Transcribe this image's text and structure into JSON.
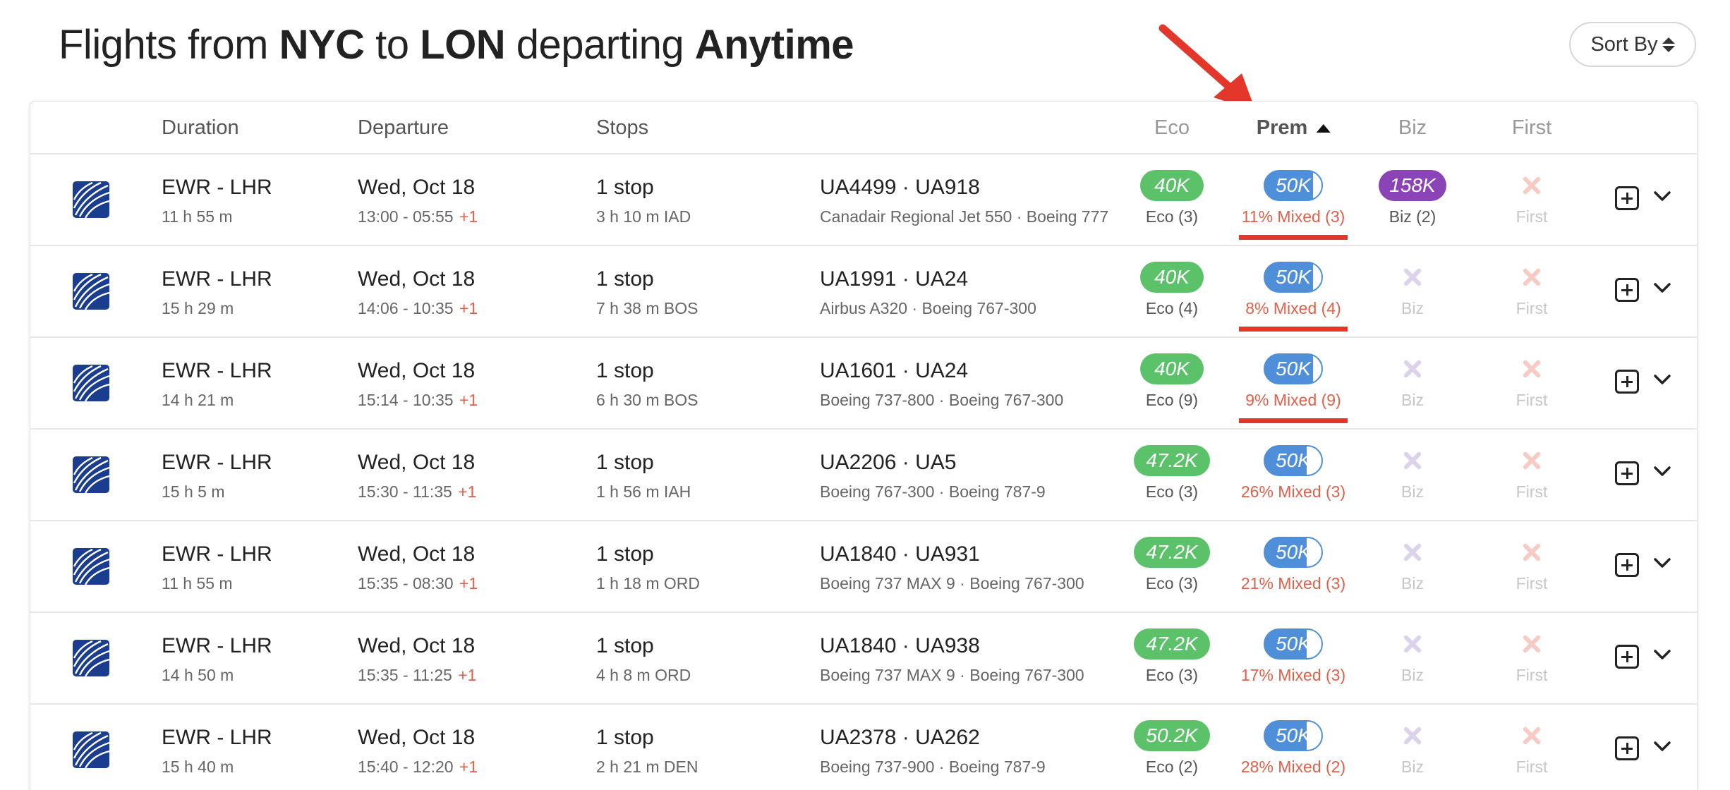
{
  "title": {
    "prefix": "Flights from",
    "origin": "NYC",
    "to": "to",
    "destination": "LON",
    "departing": "departing",
    "when": "Anytime"
  },
  "sort_label": "Sort By",
  "columns": {
    "duration": "Duration",
    "departure": "Departure",
    "stops": "Stops",
    "eco": "Eco",
    "prem": "Prem",
    "biz": "Biz",
    "first": "First"
  },
  "colors": {
    "eco": "#5cc26a",
    "prem": "#4f8fd9",
    "biz": "#8b44b8",
    "mixed_text": "#e0604a",
    "annotation": "#e2372a",
    "airline_logo": "#1a3d8f"
  },
  "rows": [
    {
      "route": "EWR - LHR",
      "duration": "11 h 55 m",
      "date": "Wed, Oct 18",
      "time": "13:00 - 05:55",
      "plus": "+1",
      "stops": "1 stop",
      "layover": "3 h 10 m  IAD",
      "flights": "UA4499  ·  UA918",
      "aircraft": "Canadair Regional Jet 550  ·  Boeing 777",
      "eco_price": "40K",
      "eco_sub": "Eco (3)",
      "prem_price": "50K",
      "prem_sub": "11% Mixed (3)",
      "biz_price": "158K",
      "biz_sub": "Biz (2)",
      "first_label": "First",
      "underline": true
    },
    {
      "route": "EWR - LHR",
      "duration": "15 h 29 m",
      "date": "Wed, Oct 18",
      "time": "14:06 - 10:35",
      "plus": "+1",
      "stops": "1 stop",
      "layover": "7 h 38 m  BOS",
      "flights": "UA1991  ·  UA24",
      "aircraft": "Airbus A320  ·  Boeing 767-300",
      "eco_price": "40K",
      "eco_sub": "Eco (4)",
      "prem_price": "50K",
      "prem_sub": "8% Mixed (4)",
      "biz_label": "Biz",
      "first_label": "First",
      "underline": true
    },
    {
      "route": "EWR - LHR",
      "duration": "14 h 21 m",
      "date": "Wed, Oct 18",
      "time": "15:14 - 10:35",
      "plus": "+1",
      "stops": "1 stop",
      "layover": "6 h 30 m  BOS",
      "flights": "UA1601  ·  UA24",
      "aircraft": "Boeing 737-800  ·  Boeing 767-300",
      "eco_price": "40K",
      "eco_sub": "Eco (9)",
      "prem_price": "50K",
      "prem_sub": "9% Mixed (9)",
      "biz_label": "Biz",
      "first_label": "First",
      "underline": true
    },
    {
      "route": "EWR - LHR",
      "duration": "15 h 5 m",
      "date": "Wed, Oct 18",
      "time": "15:30 - 11:35",
      "plus": "+1",
      "stops": "1 stop",
      "layover": "1 h 56 m  IAH",
      "flights": "UA2206  ·  UA5",
      "aircraft": "Boeing 767-300  ·  Boeing 787-9",
      "eco_price": "47.2K",
      "eco_sub": "Eco (3)",
      "prem_price": "50K",
      "prem_sub": "26% Mixed (3)",
      "biz_label": "Biz",
      "first_label": "First",
      "underline": false
    },
    {
      "route": "EWR - LHR",
      "duration": "11 h 55 m",
      "date": "Wed, Oct 18",
      "time": "15:35 - 08:30",
      "plus": "+1",
      "stops": "1 stop",
      "layover": "1 h 18 m  ORD",
      "flights": "UA1840  ·  UA931",
      "aircraft": "Boeing 737 MAX 9  ·  Boeing 767-300",
      "eco_price": "47.2K",
      "eco_sub": "Eco (3)",
      "prem_price": "50K",
      "prem_sub": "21% Mixed (3)",
      "biz_label": "Biz",
      "first_label": "First",
      "underline": false
    },
    {
      "route": "EWR - LHR",
      "duration": "14 h 50 m",
      "date": "Wed, Oct 18",
      "time": "15:35 - 11:25",
      "plus": "+1",
      "stops": "1 stop",
      "layover": "4 h 8 m  ORD",
      "flights": "UA1840  ·  UA938",
      "aircraft": "Boeing 737 MAX 9  ·  Boeing 767-300",
      "eco_price": "47.2K",
      "eco_sub": "Eco (3)",
      "prem_price": "50K",
      "prem_sub": "17% Mixed (3)",
      "biz_label": "Biz",
      "first_label": "First",
      "underline": false
    },
    {
      "route": "EWR - LHR",
      "duration": "15 h 40 m",
      "date": "Wed, Oct 18",
      "time": "15:40 - 12:20",
      "plus": "+1",
      "stops": "1 stop",
      "layover": "2 h 21 m  DEN",
      "flights": "UA2378  ·  UA262",
      "aircraft": "Boeing 737-900  ·  Boeing 787-9",
      "eco_price": "50.2K",
      "eco_sub": "Eco (2)",
      "prem_price": "50K",
      "prem_sub": "28% Mixed (2)",
      "biz_label": "Biz",
      "first_label": "First",
      "underline": false
    }
  ]
}
